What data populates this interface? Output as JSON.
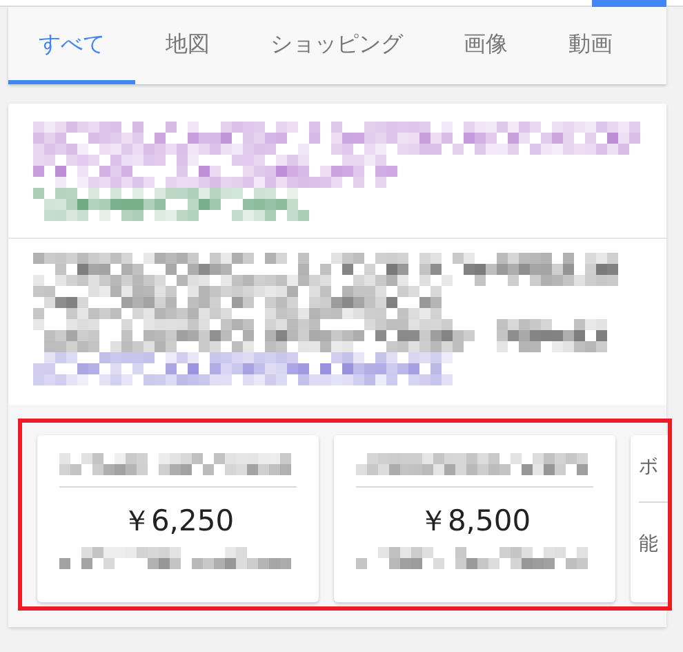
{
  "tabs": [
    {
      "label": "すべて",
      "selected": true
    },
    {
      "label": "地図",
      "selected": false
    },
    {
      "label": "ショッピング",
      "selected": false
    },
    {
      "label": "画像",
      "selected": false
    },
    {
      "label": "動画",
      "selected": false
    }
  ],
  "result": {
    "blurred_lines": [
      {
        "kind": "title"
      },
      {
        "kind": "title"
      },
      {
        "kind": "url"
      }
    ],
    "snippet_lines": [
      {
        "kind": "snippet"
      },
      {
        "kind": "snippet"
      },
      {
        "kind": "snippet"
      },
      {
        "kind": "link"
      }
    ]
  },
  "products": [
    {
      "price": "￥6,250"
    },
    {
      "price": "￥8,500"
    }
  ],
  "partial_product": {
    "title": "ボ",
    "note": "能"
  },
  "highlight": {
    "color": "#ed1c24"
  }
}
